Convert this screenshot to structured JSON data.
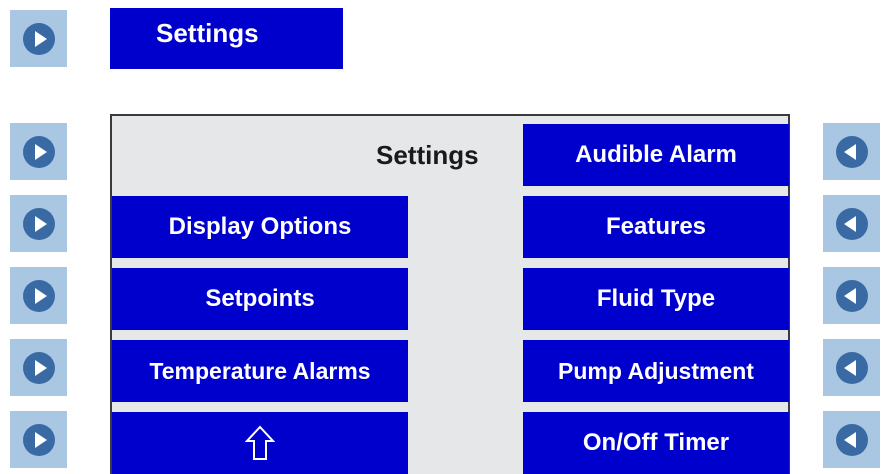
{
  "header": {
    "title": "Settings"
  },
  "screen": {
    "title": "Settings",
    "left_buttons": {
      "display_options": "Display Options",
      "setpoints": "Setpoints",
      "temperature_alarms": "Temperature Alarms",
      "home_icon": "home-arrow-icon"
    },
    "right_buttons": {
      "audible_alarm": "Audible Alarm",
      "features": "Features",
      "fluid_type": "Fluid Type",
      "pump_adjustment": "Pump Adjustment",
      "on_off_timer": "On/Off Timer"
    }
  },
  "icons": {
    "left_side_keys": "play-right-icon",
    "right_side_keys": "play-left-icon"
  },
  "colors": {
    "button_blue": "#0000cc",
    "side_key_bg": "#a9c6e3",
    "side_key_icon": "#3a6aa3",
    "screen_bg": "#e6e7e8"
  }
}
